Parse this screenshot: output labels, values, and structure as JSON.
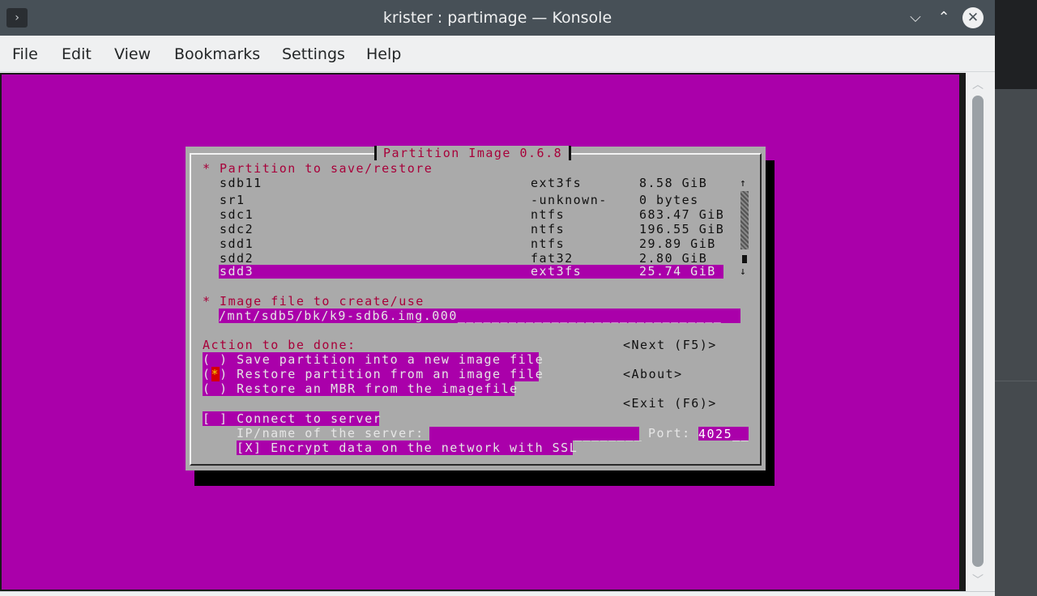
{
  "window": {
    "title": "krister : partimage — Konsole",
    "app_icon_glyph": "›",
    "minimize_glyph": "⌵",
    "maximize_glyph": "⌃",
    "close_glyph": "✕"
  },
  "menu": [
    "File",
    "Edit",
    "View",
    "Bookmarks",
    "Settings",
    "Help"
  ],
  "dialog": {
    "title": "Partition Image 0.6.8",
    "partition_header": "* Partition to save/restore",
    "partitions": [
      {
        "name": "sdb11",
        "fs": "ext3fs",
        "size": "8.58 GiB"
      },
      {
        "name": "sr1",
        "fs": "-unknown-",
        "size": "0 bytes"
      },
      {
        "name": "sdc1",
        "fs": "ntfs",
        "size": "683.47 GiB"
      },
      {
        "name": "sdc2",
        "fs": "ntfs",
        "size": "196.55 GiB"
      },
      {
        "name": "sdd1",
        "fs": "ntfs",
        "size": "29.89 GiB"
      },
      {
        "name": "sdd2",
        "fs": "fat32",
        "size": "2.80 GiB"
      },
      {
        "name": "sdd3",
        "fs": "ext3fs",
        "size": "25.74 GiB"
      }
    ],
    "selected_partition": "sdd3",
    "scroll_up_glyph": "↑",
    "scroll_down_glyph": "↓",
    "image_header": "* Image file to create/use",
    "image_file": "/mnt/sdb5/bk/k9-sdb6.img.000",
    "image_file_padding": "_______________________________",
    "action_header": "Action to be done:",
    "actions": [
      {
        "mark": "( )",
        "label": "Save partition into a new image file"
      },
      {
        "mark_open": "(",
        "mark_star": "*",
        "mark_close": ")",
        "label": "Restore partition from an image file"
      },
      {
        "mark": "( )",
        "label": "Restore an MBR from the imagefile"
      }
    ],
    "selected_action": "Restore partition from an image file",
    "buttons": {
      "next": "<Next (F5)>",
      "about": "<About>",
      "exit": "<Exit (F6)>"
    },
    "connect_checkbox": "[ ]",
    "connect_label": "Connect to server",
    "server_label": "IP/name of the server:",
    "server_value": "_________________________",
    "port_label": "Port:",
    "port_value": "4025__",
    "ssl_checkbox": "[X]",
    "ssl_label": "Encrypt data on the network with SSL"
  },
  "colors": {
    "terminal_bg": "#aa00aa",
    "dialog_bg": "#aaaaaa",
    "title_red": "#a8003a",
    "titlebar": "#475057"
  }
}
